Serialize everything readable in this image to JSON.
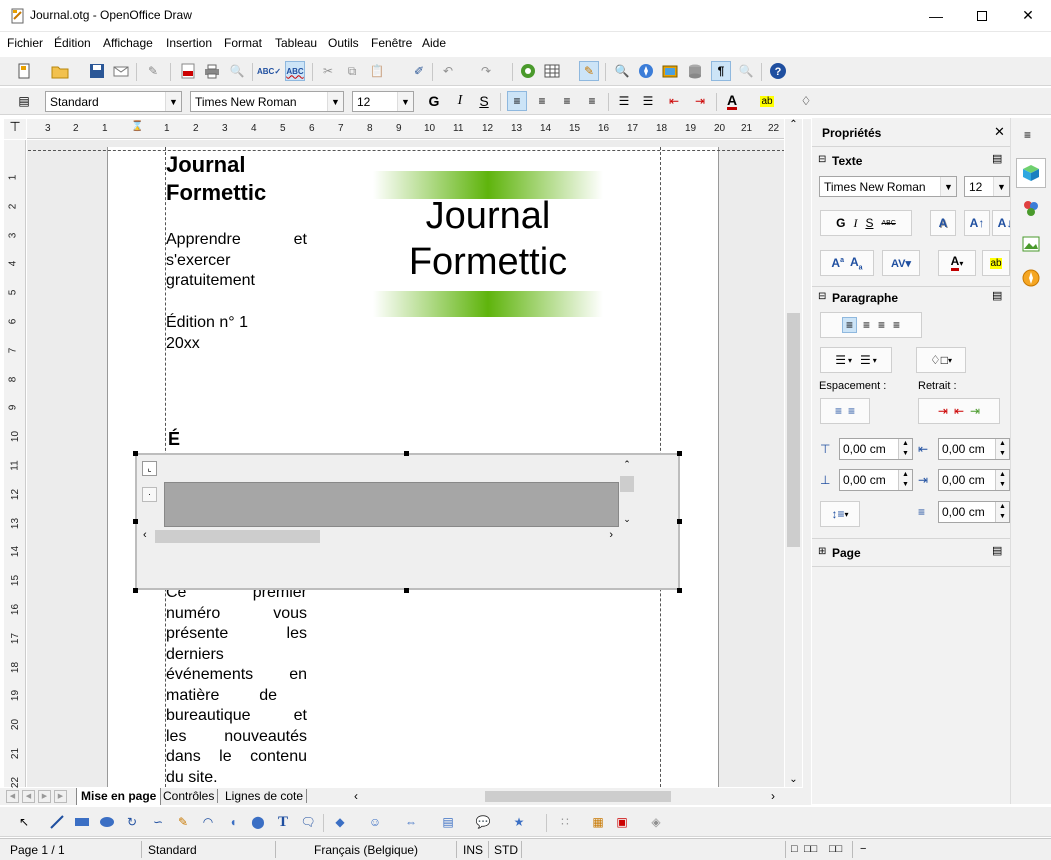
{
  "window": {
    "title": "Journal.otg - OpenOffice Draw"
  },
  "menu": [
    "Fichier",
    "Édition",
    "Affichage",
    "Insertion",
    "Format",
    "Tableau",
    "Outils",
    "Fenêtre",
    "Aide"
  ],
  "format_toolbar": {
    "style": "Standard",
    "font": "Times New Roman",
    "size": "12"
  },
  "ruler": {
    "marks": [
      "3",
      "2",
      "1",
      "1",
      "2",
      "3",
      "4",
      "5",
      "6",
      "7",
      "8",
      "9",
      "10",
      "11",
      "12",
      "13",
      "14",
      "15",
      "16",
      "17",
      "18",
      "19",
      "20",
      "21",
      "22"
    ],
    "vmarks": [
      "1",
      "2",
      "3",
      "4",
      "5",
      "6",
      "7",
      "8",
      "9",
      "10",
      "11",
      "12",
      "13",
      "14",
      "15",
      "16",
      "17",
      "18",
      "19",
      "20",
      "21",
      "22"
    ]
  },
  "document": {
    "title_lines": [
      "Journal",
      "Formettic"
    ],
    "tagline": [
      "Apprendre",
      "et",
      "s'exercer",
      "gratuitement"
    ],
    "edition": [
      "Édition n° 1",
      "20xx"
    ],
    "banner_lines": [
      "Journal",
      "Formettic"
    ],
    "partial_heading": "É",
    "body_first_line": [
      "Ce",
      "premier"
    ],
    "body_lines": [
      [
        "numéro",
        "vous"
      ],
      [
        "présente",
        "les"
      ],
      [
        "derniers"
      ],
      [
        "événements",
        "en"
      ],
      [
        "matière",
        "de"
      ],
      [
        "bureautique",
        "et"
      ],
      [
        "les",
        "nouveautés"
      ],
      [
        "dans",
        "le",
        "contenu"
      ],
      [
        "du site."
      ]
    ]
  },
  "page_tabs": [
    "Mise en page",
    "Contrôles",
    "Lignes de cote"
  ],
  "sidebar": {
    "title": "Propriétés",
    "text_section": "Texte",
    "font": "Times New Roman",
    "size": "12",
    "paragraph_section": "Paragraphe",
    "spacing_label": "Espacement :",
    "indent_label": "Retrait :",
    "spacing_above": "0,00 cm",
    "spacing_below": "0,00 cm",
    "indent_before": "0,00 cm",
    "indent_after": "0,00 cm",
    "first_line": "0,00 cm",
    "page_section": "Page"
  },
  "status": {
    "page": "Page 1 / 1",
    "style": "Standard",
    "language": "Français (Belgique)",
    "ins": "INS",
    "std": "STD"
  },
  "colors": {
    "accent_green": "#5fb40c",
    "toolbar_bg": "#f0f0f0",
    "selection_blue": "#cce4f7",
    "font_color_red": "#c00000",
    "highlight_yellow": "#ffff00"
  }
}
